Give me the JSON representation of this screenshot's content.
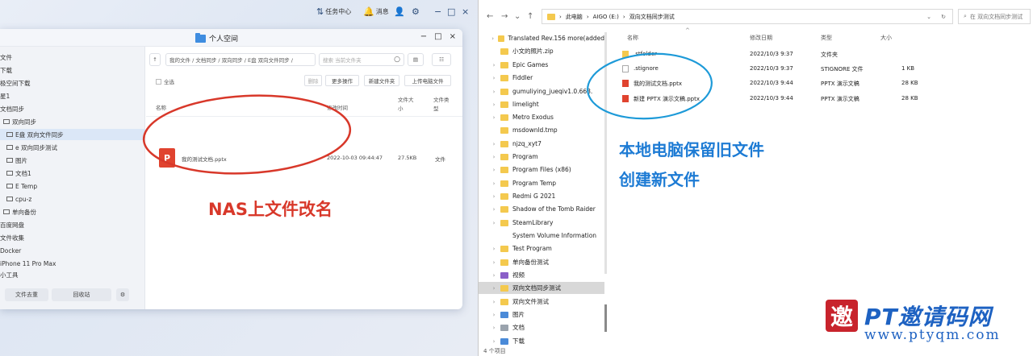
{
  "colors": {
    "annotation_red": "#d8382a",
    "annotation_blue": "#1d7bd4",
    "nas_folder": "#3f8de0",
    "pptx": "#e0432f"
  },
  "taskbar": {
    "task_center": "任务中心",
    "messages": "消息"
  },
  "nas": {
    "title": "个人空间",
    "sidebar": [
      "文件",
      "下载",
      "极空间下载",
      "星1",
      "文档同步",
      "双向同步",
      "E盘 双向文件同步",
      "e 双向同步测试",
      "图片",
      "文档1",
      "E Temp",
      "cpu-z",
      "单向备份",
      "百度网盘",
      "文件收集",
      "Docker",
      "iPhone 11 Pro Max",
      "小工具"
    ],
    "bottom_buttons": {
      "recent": "文件去重",
      "recycle": "回收站"
    },
    "path": "我的文件 / 文档同步 / 双向同步 / E盘 双向文件同步 /",
    "search_placeholder": "搜索 当前文件夹",
    "select_all": "全选",
    "toolbar": {
      "delete": "删除",
      "more": "更多操作",
      "new_folder": "新建文件夹",
      "upload": "上传电脑文件"
    },
    "headers": {
      "name": "名称",
      "modified": "修改时间",
      "size": "文件大小",
      "type": "文件类型"
    },
    "files": [
      {
        "icon": "P",
        "name": "我的测试文档.pptx",
        "modified": "2022-10-03 09:44:47",
        "size": "27.5KB",
        "type": "文件"
      }
    ]
  },
  "annotations": {
    "left": "NAS上文件改名",
    "right_line1": "本地电脑保留旧文件",
    "right_line2": "创建新文件"
  },
  "explorer": {
    "breadcrumb": [
      "此电脑",
      "AIGO (E:)",
      "双向文档同步测试"
    ],
    "search_placeholder": "在 双向文档同步测试",
    "tree": [
      "Translated Rev.156 more(added",
      "小文的照片.zip",
      "Epic Games",
      "Fiddler",
      "gumuliying_jueqiv1.0.668.",
      "limelight",
      "Metro Exodus",
      "msdownld.tmp",
      "njzq_xyt7",
      "Program",
      "Program Files (x86)",
      "Program Temp",
      "Redmi G 2021",
      "Shadow of the Tomb Raider",
      "SteamLibrary",
      "System Volume Information",
      "Test Program",
      "单向备份测试",
      "视频",
      "双向文档同步测试",
      "双向文件测试",
      "图片",
      "文档",
      "下载"
    ],
    "headers": {
      "name": "名称",
      "modified": "修改日期",
      "type": "类型",
      "size": "大小"
    },
    "files": [
      {
        "name": ".stfolder",
        "modified": "2022/10/3 9:37",
        "type": "文件夹",
        "size": ""
      },
      {
        "name": ".stignore",
        "modified": "2022/10/3 9:37",
        "type": "STIGNORE 文件",
        "size": "1 KB"
      },
      {
        "name": "我的测试文档.pptx",
        "modified": "2022/10/3 9:44",
        "type": "PPTX 演示文稿",
        "size": "28 KB"
      },
      {
        "name": "新建 PPTX 演示文稿.pptx",
        "modified": "2022/10/3 9:44",
        "type": "PPTX 演示文稿",
        "size": "28 KB"
      }
    ],
    "status": "4 个项目"
  },
  "watermark": {
    "brand": "PT邀请码网",
    "url": "www.ptyqm.com",
    "seal": "邀"
  }
}
